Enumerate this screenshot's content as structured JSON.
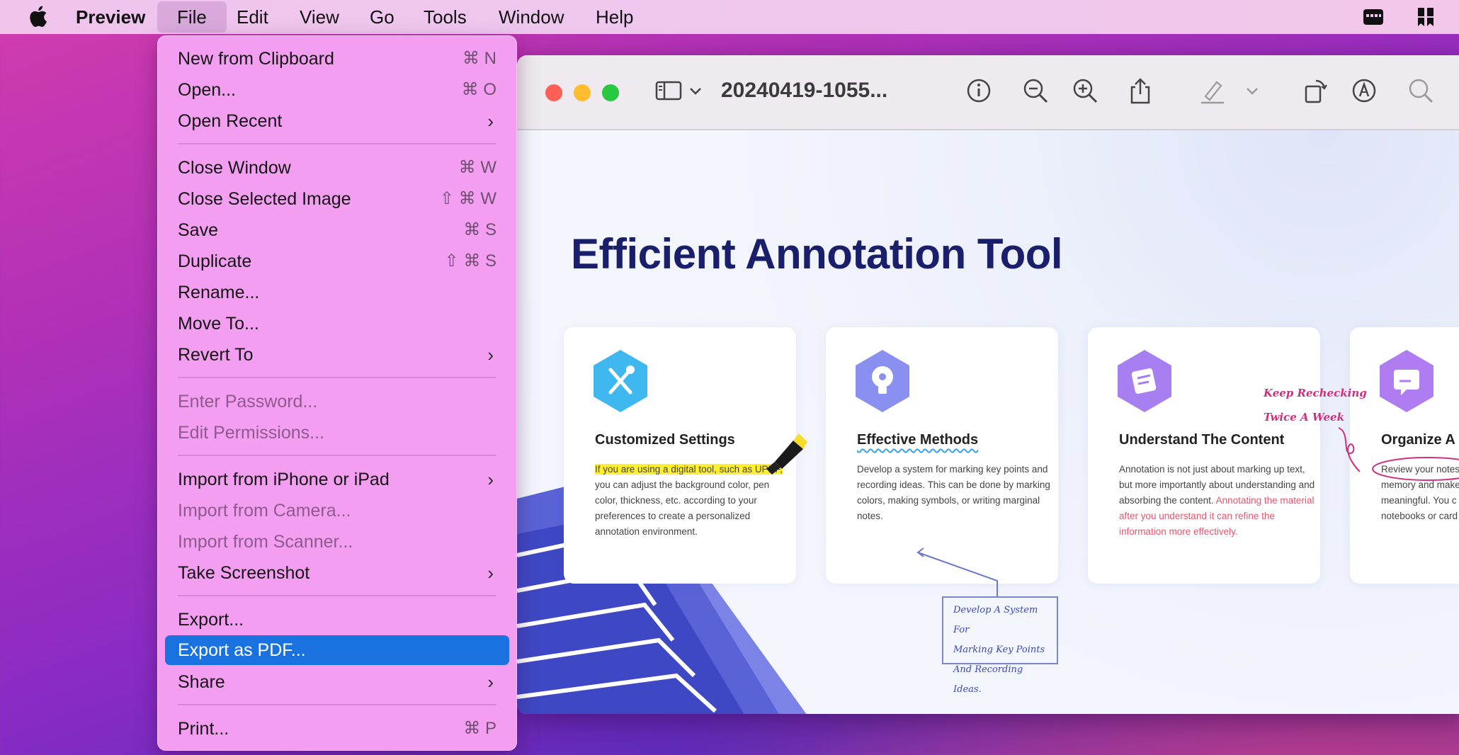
{
  "menubar": {
    "app_name": "Preview",
    "items": [
      "File",
      "Edit",
      "View",
      "Go",
      "Tools",
      "Window",
      "Help"
    ]
  },
  "file_menu": {
    "items": [
      {
        "label": "New from Clipboard",
        "shortcut": "⌘ N"
      },
      {
        "label": "Open...",
        "shortcut": "⌘ O"
      },
      {
        "label": "Open Recent",
        "submenu": true
      },
      {
        "label": "Close Window",
        "shortcut": "⌘ W"
      },
      {
        "label": "Close Selected Image",
        "shortcut": "⇧ ⌘ W"
      },
      {
        "label": "Save",
        "shortcut": "⌘ S"
      },
      {
        "label": "Duplicate",
        "shortcut": "⇧ ⌘ S"
      },
      {
        "label": "Rename..."
      },
      {
        "label": "Move To..."
      },
      {
        "label": "Revert To",
        "submenu": true
      },
      {
        "label": "Enter Password...",
        "disabled": true
      },
      {
        "label": "Edit Permissions...",
        "disabled": true
      },
      {
        "label": "Import from iPhone or iPad",
        "submenu": true
      },
      {
        "label": "Import from Camera...",
        "disabled": true
      },
      {
        "label": "Import from Scanner...",
        "disabled": true
      },
      {
        "label": "Take Screenshot",
        "submenu": true
      },
      {
        "label": "Export..."
      },
      {
        "label": "Export as PDF...",
        "selected": true
      },
      {
        "label": "Share",
        "submenu": true
      },
      {
        "label": "Print...",
        "shortcut": "⌘ P"
      }
    ],
    "chevron": "›"
  },
  "window": {
    "title": "20240419-1055...",
    "traffic_lights": {
      "close": "#fe5f57",
      "minimize": "#febc2e",
      "zoom": "#28c840"
    }
  },
  "document": {
    "title": "Efficient Annotation Tool",
    "cards": [
      {
        "title": "Customized Settings",
        "highlight": "If you are using a digital tool, such as UPDF,",
        "text": " you can adjust the background color, pen color, thickness, etc. according to your preferences to create a personalized annotation environment."
      },
      {
        "title": "Effective Methods",
        "text": "Develop a system for marking key points and recording ideas. This can be done by marking colors, making symbols, or writing marginal notes."
      },
      {
        "title": "Understand The Content",
        "text": "Annotation is not just about marking up text, but more importantly about understanding and absorbing the content. ",
        "pink_text": "Annotating the material after you understand it can refine the information more effectively."
      },
      {
        "title": "Organize A",
        "text": "Review your notes memory and make meaningful. You c notebooks or card"
      }
    ],
    "note_box": [
      "Develop A System For",
      "Marking Key Points",
      "And Recording Ideas."
    ],
    "handwritten": [
      "Keep Rechecking",
      "Twice A Week"
    ]
  },
  "colors": {
    "accent": "#1a72e0",
    "title_navy": "#1a1f6b",
    "highlight": "#ffef2e"
  }
}
